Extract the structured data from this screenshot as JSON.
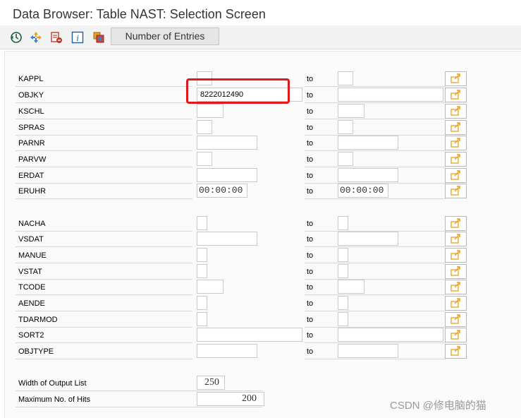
{
  "window": {
    "title": "Data Browser: Table NAST: Selection Screen"
  },
  "toolbar": {
    "icons": [
      "execute-icon",
      "object-list-icon",
      "delete-selection-icon",
      "info-icon",
      "copy-selection-icon"
    ],
    "number_of_entries_label": "Number of Entries"
  },
  "range_label": "to",
  "selection_fields": [
    {
      "label": "KAPPL",
      "low": "",
      "high": ""
    },
    {
      "label": "OBJKY",
      "low": "8222012490",
      "high": ""
    },
    {
      "label": "KSCHL",
      "low": "",
      "high": ""
    },
    {
      "label": "SPRAS",
      "low": "",
      "high": ""
    },
    {
      "label": "PARNR",
      "low": "",
      "high": ""
    },
    {
      "label": "PARVW",
      "low": "",
      "high": ""
    },
    {
      "label": "ERDAT",
      "low": "",
      "high": ""
    },
    {
      "label": "ERUHR",
      "low": "00:00:00",
      "high": "00:00:00"
    },
    {
      "label": "NACHA",
      "low": "",
      "high": ""
    },
    {
      "label": "VSDAT",
      "low": "",
      "high": ""
    },
    {
      "label": "MANUE",
      "low": "",
      "high": ""
    },
    {
      "label": "VSTAT",
      "low": "",
      "high": ""
    },
    {
      "label": "TCODE",
      "low": "",
      "high": ""
    },
    {
      "label": "AENDE",
      "low": "",
      "high": ""
    },
    {
      "label": "TDARMOD",
      "low": "",
      "high": ""
    },
    {
      "label": "SORT2",
      "low": "",
      "high": ""
    },
    {
      "label": "OBJTYPE",
      "low": "",
      "high": ""
    }
  ],
  "output_settings": {
    "width_label": "Width of Output List",
    "width_value": "250",
    "max_hits_label": "Maximum No. of Hits",
    "max_hits_value": "200"
  },
  "colors": {
    "highlight": "#e0191f",
    "multi_select_arrow": "#e8a020"
  },
  "watermark": "CSDN @修电脑的猫"
}
